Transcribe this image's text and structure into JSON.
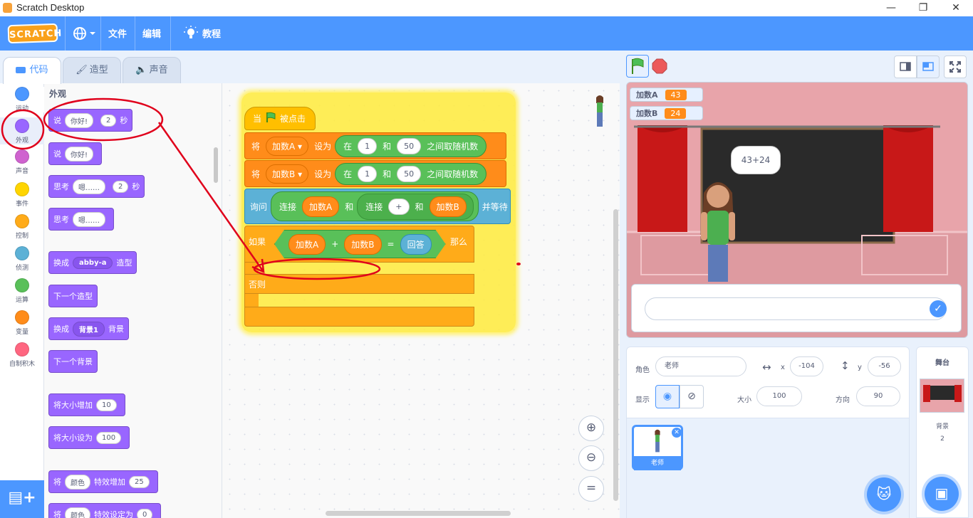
{
  "window": {
    "title": "Scratch Desktop",
    "minimize_icon": "—",
    "restore_icon": "❐",
    "close_icon": "✕"
  },
  "menu": {
    "logo": "SCRATCH",
    "language_icon": "globe-icon",
    "file": "文件",
    "edit": "编辑",
    "tutorials": "教程"
  },
  "tabs": {
    "code": "代码",
    "costumes": "造型",
    "sounds": "声音"
  },
  "categories": [
    {
      "label": "运动",
      "color": "#4c97ff"
    },
    {
      "label": "外观",
      "color": "#9966ff"
    },
    {
      "label": "声音",
      "color": "#cf63cf"
    },
    {
      "label": "事件",
      "color": "#ffd500"
    },
    {
      "label": "控制",
      "color": "#ffab19"
    },
    {
      "label": "侦测",
      "color": "#5cb1d6"
    },
    {
      "label": "运算",
      "color": "#59c059"
    },
    {
      "label": "变量",
      "color": "#ff8c1a"
    },
    {
      "label": "自制积木",
      "color": "#ff6680"
    }
  ],
  "palette": {
    "heading": "外观",
    "say_secs": {
      "say": "说",
      "msg": "你好!",
      "secs": "2",
      "unit": "秒"
    },
    "say": {
      "say": "说",
      "msg": "你好!"
    },
    "think_secs": {
      "think": "思考",
      "msg": "嗯……",
      "secs": "2",
      "unit": "秒"
    },
    "think": {
      "think": "思考",
      "msg": "嗯……"
    },
    "switch_costume": {
      "pre": "换成",
      "val": "abby-a",
      "post": "造型"
    },
    "next_costume": "下一个造型",
    "switch_backdrop": {
      "pre": "换成",
      "val": "背景1",
      "post": "背景"
    },
    "next_backdrop": "下一个背景",
    "change_size": {
      "pre": "将大小增加",
      "val": "10"
    },
    "set_size": {
      "pre": "将大小设为",
      "val": "100"
    },
    "change_effect": {
      "pre": "将",
      "val": "颜色",
      "mid": "特效增加",
      "num": "25"
    },
    "set_effect": {
      "pre": "将",
      "val": "颜色",
      "mid": "特效设定为",
      "num": "0"
    }
  },
  "script": {
    "hat": {
      "when": "当",
      "clicked": "被点击"
    },
    "set_a": {
      "set": "将",
      "var": "加数A",
      "to": "设为",
      "in": "在",
      "from": "1",
      "and": "和",
      "to_val": "50",
      "rand": "之间取随机数"
    },
    "set_b": {
      "set": "将",
      "var": "加数B",
      "to": "设为",
      "in": "在",
      "from": "1",
      "and": "和",
      "to_val": "50",
      "rand": "之间取随机数"
    },
    "ask": {
      "ask": "询问",
      "join1": "连接",
      "var_a": "加数A",
      "and1": "和",
      "join2": "连接",
      "plus": "+",
      "and2": "和",
      "var_b": "加数B",
      "wait": "并等待"
    },
    "if": {
      "if": "如果",
      "var_a": "加数A",
      "plus": "+",
      "var_b": "加数B",
      "eq": "=",
      "answer": "回答",
      "then": "那么"
    },
    "else": "否则"
  },
  "stage": {
    "monitors": [
      {
        "name": "加数A",
        "value": "43"
      },
      {
        "name": "加数B",
        "value": "24"
      }
    ],
    "speech": "43+24"
  },
  "sprite_info": {
    "sprite_label": "角色",
    "sprite_name": "老师",
    "x_label": "x",
    "x": "-104",
    "y_label": "y",
    "y": "-56",
    "show_label": "显示",
    "size_label": "大小",
    "size": "100",
    "direction_label": "方向",
    "direction": "90"
  },
  "sprites": [
    {
      "name": "老师"
    }
  ],
  "stage_panel": {
    "title": "舞台",
    "backdrops_label": "背景",
    "backdrops_count": "2"
  },
  "colors": {
    "accent": "#4c97ff",
    "looks": "#9966ff",
    "operators": "#59c059",
    "variables": "#ff8c1a",
    "control": "#ffab19",
    "sensing": "#5cb1d6",
    "annotation": "#e0001b"
  }
}
